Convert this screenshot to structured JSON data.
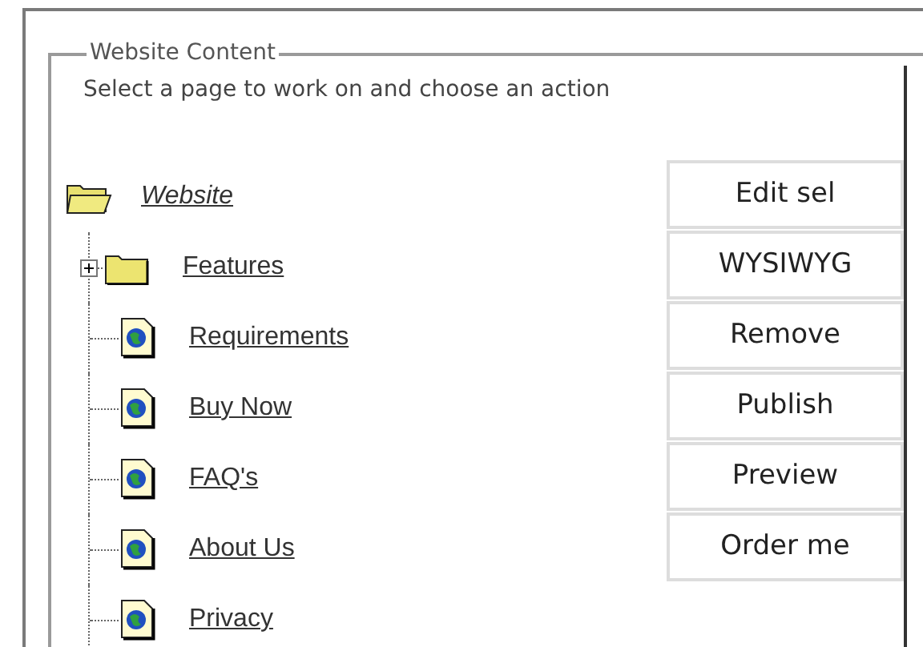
{
  "panel": {
    "legend": "Website Content",
    "instruction": "Select a page to work on and choose an action"
  },
  "tree": {
    "label": "Website",
    "expanded": true,
    "children": [
      {
        "label": "Features",
        "kind": "folder",
        "expanded": false
      },
      {
        "label": "Requirements",
        "kind": "page"
      },
      {
        "label": "Buy Now",
        "kind": "page"
      },
      {
        "label": "FAQ's",
        "kind": "page"
      },
      {
        "label": "About Us",
        "kind": "page"
      },
      {
        "label": "Privacy",
        "kind": "page"
      }
    ]
  },
  "actions": [
    "Edit sel",
    "WYSIWYG",
    "Remove",
    "Publish",
    "Preview",
    "Order me"
  ]
}
